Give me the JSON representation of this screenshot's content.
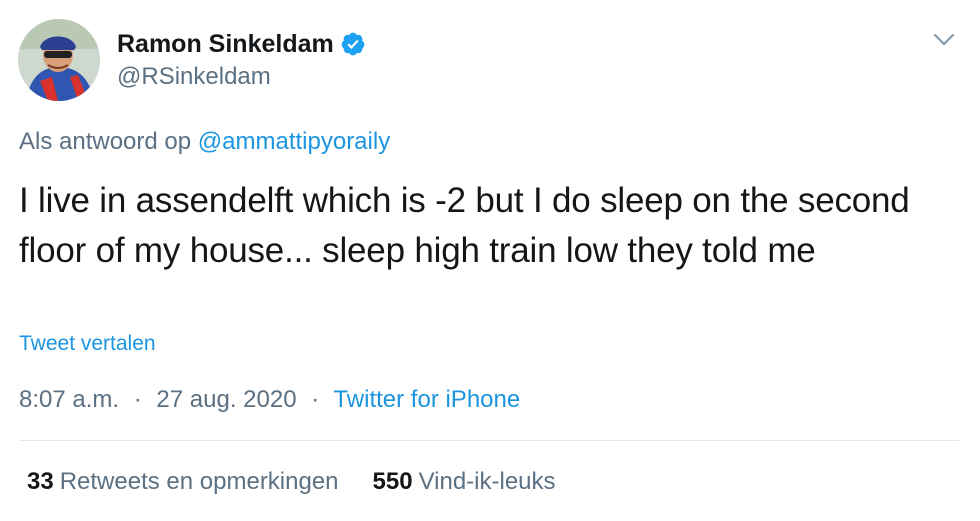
{
  "user": {
    "display_name": "Ramon Sinkeldam",
    "handle": "@RSinkeldam",
    "verified": true
  },
  "reply": {
    "prefix": "Als antwoord op",
    "mention": "@ammattipyoraily"
  },
  "tweet": {
    "text": "I live in assendelft which is -2 but I do sleep on the second floor of my house... sleep high train low they told me",
    "translate_label": "Tweet vertalen"
  },
  "meta": {
    "time": "8:07 a.m.",
    "separator": "·",
    "date": "27 aug. 2020",
    "source": "Twitter for iPhone"
  },
  "stats": {
    "retweets_count": "33",
    "retweets_label": "Retweets en opmerkingen",
    "likes_count": "550",
    "likes_label": "Vind-ik-leuks"
  },
  "icons": {
    "verified": "verified-badge-icon",
    "menu": "chevron-down-icon"
  },
  "colors": {
    "accent": "#1b95e0",
    "secondary_text": "#5b7083",
    "primary_text": "#14171a",
    "divider": "#e1e8ed"
  }
}
